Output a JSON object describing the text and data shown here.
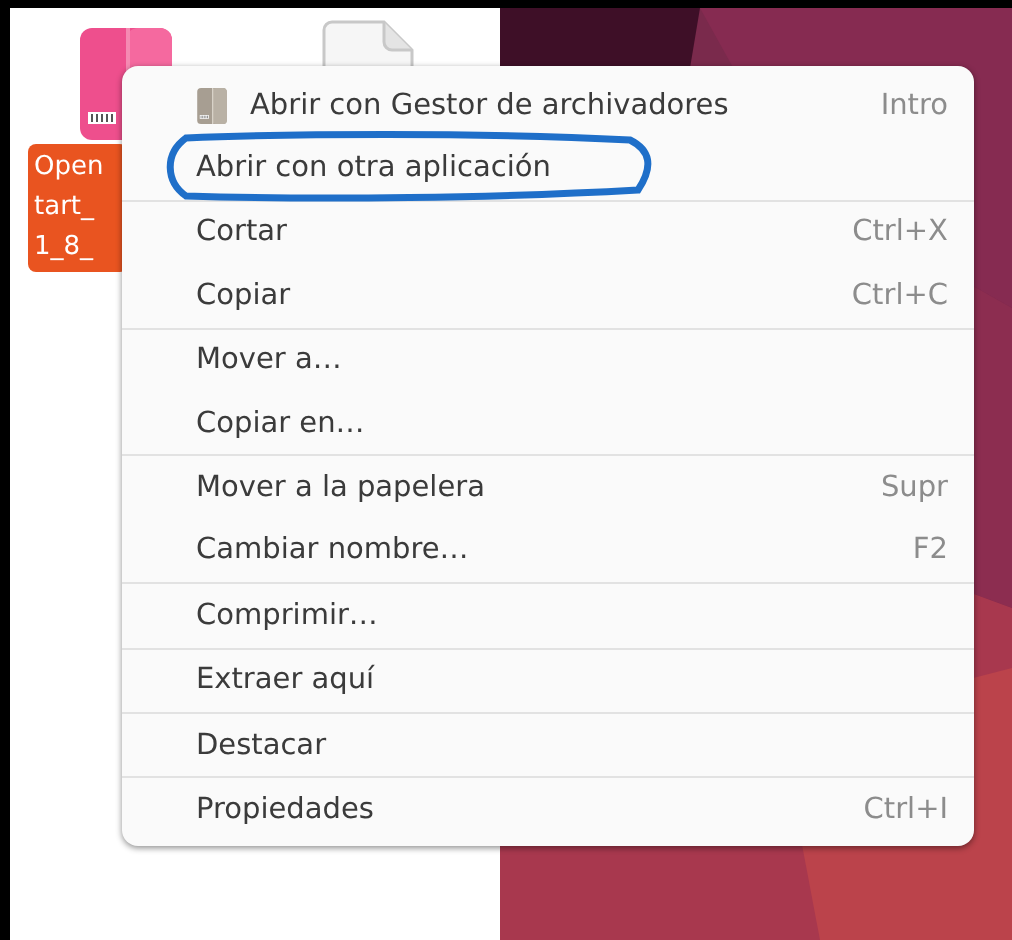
{
  "desktop": {
    "icons": [
      {
        "kind": "archive",
        "label_lines": [
          "Open",
          "tart_",
          "1_8_"
        ],
        "selected": true
      },
      {
        "kind": "document"
      }
    ]
  },
  "menu": {
    "sections": [
      {
        "items": [
          {
            "label": "Abrir con Gestor de archivadores",
            "shortcut": "Intro",
            "circled": false
          },
          {
            "label": "Abrir con otra aplicación",
            "circled": true
          }
        ]
      },
      {
        "items": [
          {
            "label": "Cortar",
            "shortcut": "Ctrl+X",
            "circled": false
          },
          {
            "label": "Copiar",
            "shortcut": "Ctrl+C",
            "circled": false
          }
        ]
      },
      {
        "items": [
          {
            "label": "Mover a…",
            "circled": false
          },
          {
            "label": "Copiar en…",
            "circled": false
          }
        ]
      },
      {
        "items": [
          {
            "label": "Mover a la papelera",
            "shortcut": "Supr",
            "circled": false
          },
          {
            "label": "Cambiar nombre…",
            "shortcut": "F2",
            "circled": false
          }
        ]
      },
      {
        "items": [
          {
            "label": "Comprimir…",
            "circled": false
          }
        ]
      },
      {
        "items": [
          {
            "label": "Extraer aquí",
            "circled": false
          }
        ]
      },
      {
        "items": [
          {
            "label": "Destacar",
            "circled": false
          }
        ]
      },
      {
        "items": [
          {
            "label": "Propiedades",
            "shortcut": "Ctrl+I",
            "circled": false
          }
        ]
      }
    ]
  }
}
